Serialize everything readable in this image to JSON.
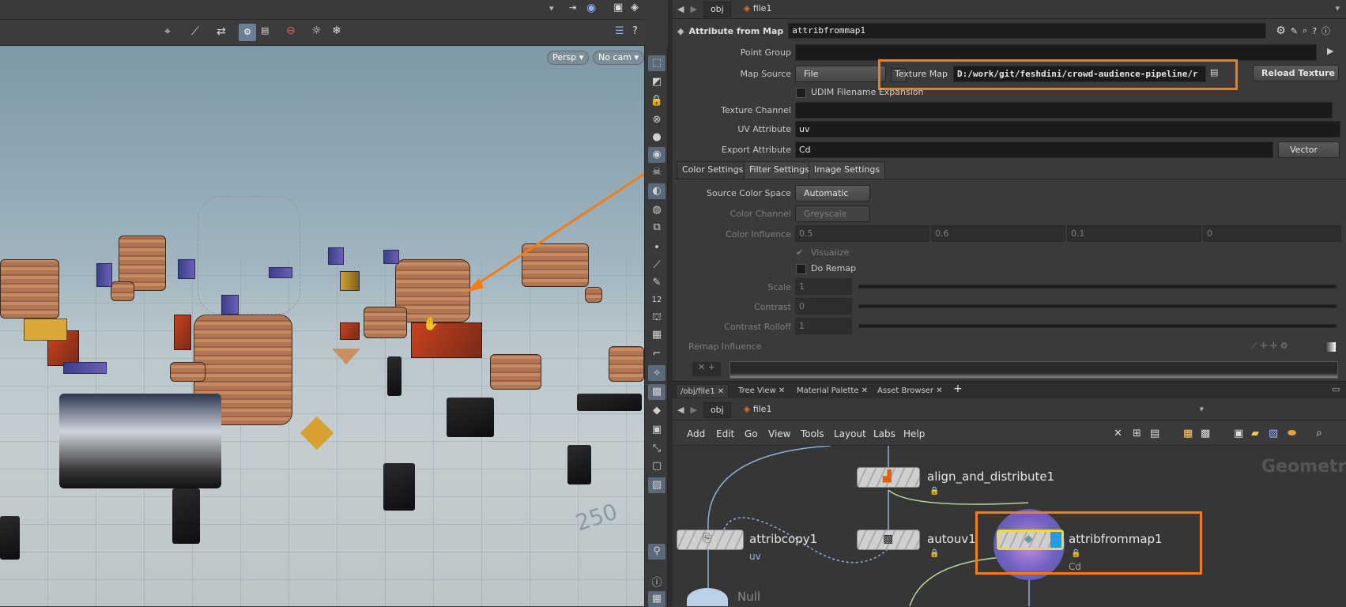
{
  "viewport": {
    "persp_label": "Persp",
    "cam_label": "No cam",
    "grid_number": "250"
  },
  "param_pane": {
    "path": {
      "obj": "obj",
      "node": "file1"
    },
    "node_type": "Attribute from Map",
    "node_name": "attribfrommap1",
    "point_group_label": "Point Group",
    "point_group_value": "",
    "map_source_label": "Map Source",
    "map_source_value": "File",
    "texture_map_label": "Texture Map",
    "texture_map_value": "D:/work/git/feshdini/crowd-audience-pipeline/r",
    "reload_texture": "Reload Texture",
    "udim_label": "UDIM Filename Expansion",
    "texture_channel_label": "Texture Channel",
    "texture_channel_value": "",
    "uv_attribute_label": "UV Attribute",
    "uv_attribute_value": "uv",
    "export_attribute_label": "Export Attribute",
    "export_attribute_value": "Cd",
    "export_type": "Vector",
    "tabs": [
      "Color Settings",
      "Filter Settings",
      "Image Settings"
    ],
    "source_color_space_label": "Source Color Space",
    "source_color_space_value": "Automatic",
    "color_channel_label": "Color Channel",
    "color_channel_value": "Greyscale",
    "color_influence_label": "Color Influence",
    "color_influence_values": [
      "0.5",
      "0.6",
      "0.1",
      "0"
    ],
    "visualize_label": "Visualize",
    "do_remap_label": "Do Remap",
    "scale_label": "Scale",
    "scale_value": "1",
    "contrast_label": "Contrast",
    "contrast_value": "0",
    "contrast_rolloff_label": "Contrast Rolloff",
    "contrast_rolloff_value": "1",
    "remap_influence_label": "Remap Influence"
  },
  "network": {
    "tabs": [
      "/obj/file1",
      "Tree View",
      "Material Palette",
      "Asset Browser"
    ],
    "path": {
      "obj": "obj",
      "node": "file1"
    },
    "menu": [
      "Add",
      "Edit",
      "Go",
      "View",
      "Tools",
      "Layout",
      "Labs",
      "Help"
    ],
    "context_label": "Geometry",
    "nodes": {
      "align": "align_and_distribute1",
      "attribcopy": "attribcopy1",
      "attribcopy_sub": "uv",
      "autouv": "autouv1",
      "attribfrommap": "attribfrommap1",
      "attribfrommap_sub": "Cd",
      "null": "Null"
    }
  },
  "colors": {
    "highlight": "#f07d18",
    "selected_node": "#f5d442",
    "panel": "#3a3a3a"
  }
}
